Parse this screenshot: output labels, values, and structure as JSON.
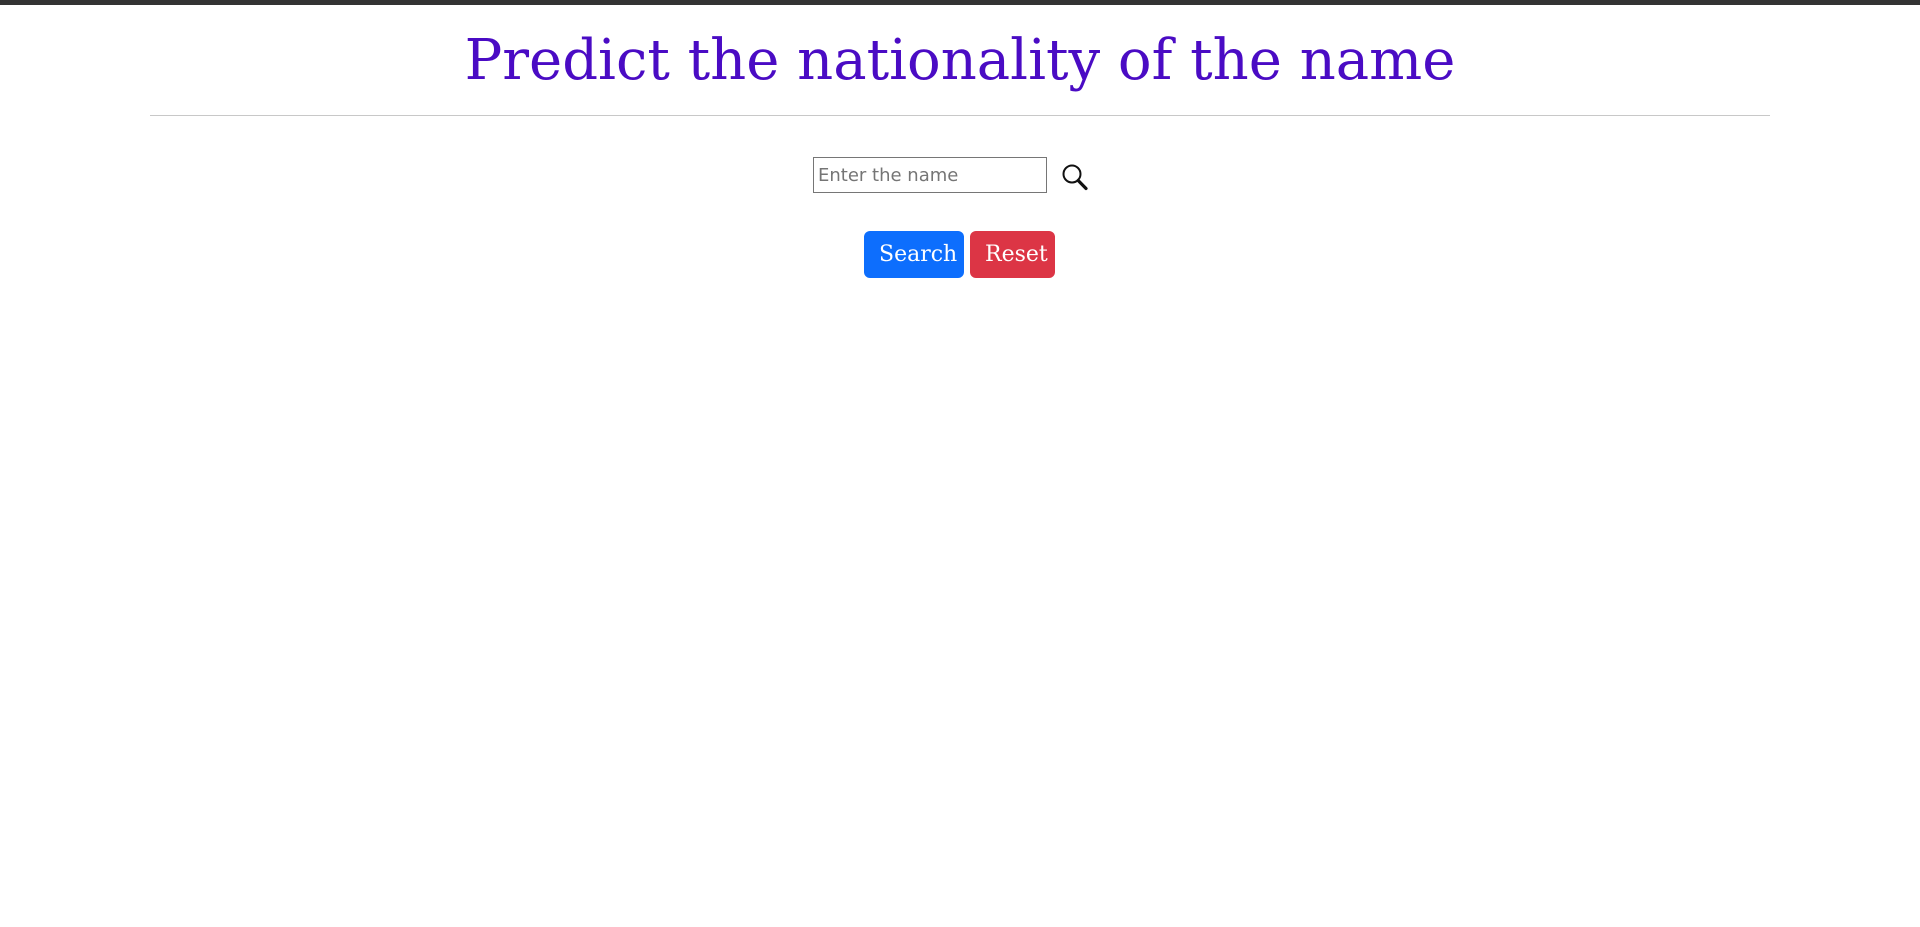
{
  "header": {
    "title": "Predict the nationality of the name"
  },
  "search": {
    "placeholder": "Enter the name",
    "value": "",
    "icon": "search-icon"
  },
  "actions": {
    "search_label": "Search",
    "reset_label": "Reset"
  },
  "colors": {
    "title": "#4a0bc4",
    "search_button": "#0d6efd",
    "reset_button": "#dc3545"
  }
}
